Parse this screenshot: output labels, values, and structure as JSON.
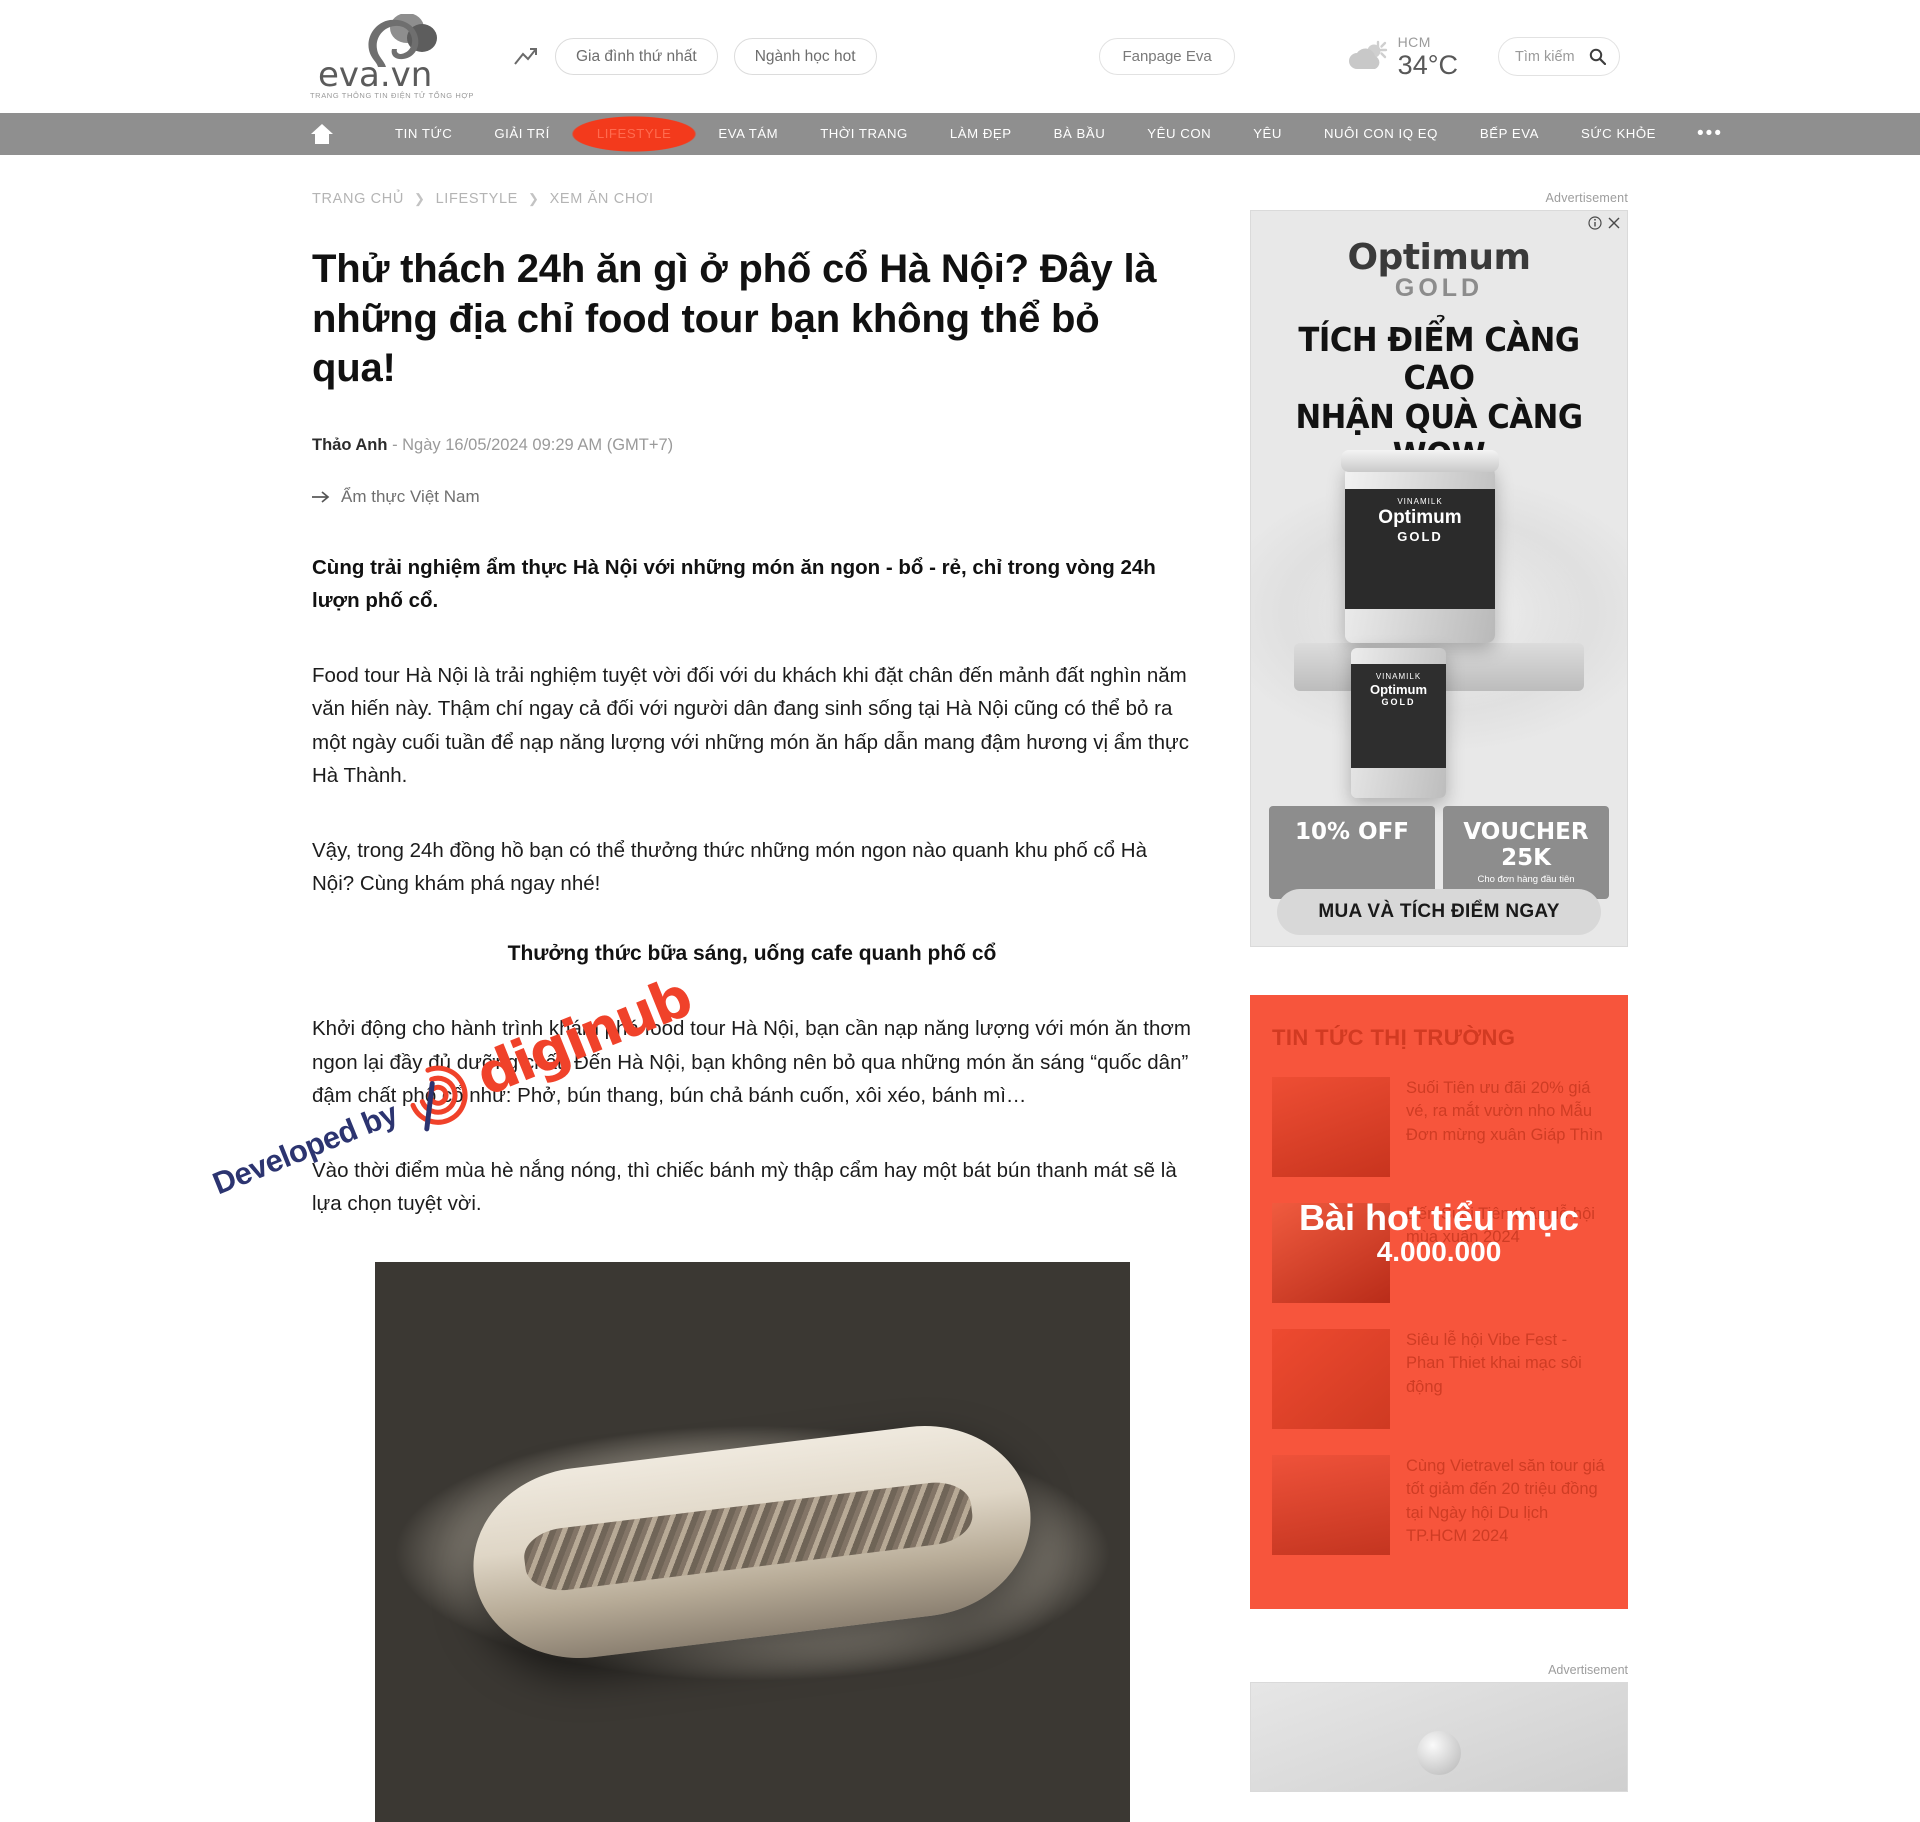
{
  "header": {
    "logo": {
      "name": "eva.vn",
      "tagline": "TRANG THÔNG TIN ĐIỆN TỬ TỔNG HỢP"
    },
    "trend_icon": "trending-up-icon",
    "hot_topics": [
      "Gia đình thứ nhất",
      "Ngành học hot"
    ],
    "fanpage_label": "Fanpage Eva",
    "weather": {
      "icon": "cloud-sun-icon",
      "city": "HCM",
      "temperature": "34°C"
    },
    "search": {
      "placeholder": "Tìm kiếm",
      "icon": "search-icon"
    }
  },
  "nav": {
    "home_icon": "home-icon",
    "items": [
      {
        "label": "TIN TỨC",
        "active": false
      },
      {
        "label": "GIẢI TRÍ",
        "active": false
      },
      {
        "label": "LIFESTYLE",
        "active": true
      },
      {
        "label": "EVA TÁM",
        "active": false
      },
      {
        "label": "THỜI TRANG",
        "active": false
      },
      {
        "label": "LÀM ĐẸP",
        "active": false
      },
      {
        "label": "BÀ BẦU",
        "active": false
      },
      {
        "label": "YÊU CON",
        "active": false
      },
      {
        "label": "YÊU",
        "active": false
      },
      {
        "label": "NUÔI CON IQ EQ",
        "active": false
      },
      {
        "label": "BẾP EVA",
        "active": false
      },
      {
        "label": "SỨC KHỎE",
        "active": false
      }
    ],
    "more_label": "•••"
  },
  "article": {
    "breadcrumb": [
      "TRANG CHỦ",
      "LIFESTYLE",
      "XEM ĂN CHƠI"
    ],
    "breadcrumb_separator": "❯",
    "title": "Thử thách 24h ăn gì ở phố cổ Hà Nội? Đây là những địa chỉ food tour bạn không thể bỏ qua!",
    "author": "Thảo Anh",
    "date": "- Ngày 16/05/2024 09:29 AM (GMT+7)",
    "topic_icon": "arrow-right-icon",
    "topic": "Ẩm thực Việt Nam",
    "sapo": "Cùng trải nghiệm ẩm thực Hà Nội với những món ăn ngon - bổ - rẻ, chỉ trong vòng 24h lượn phố cổ.",
    "paragraph_1": "Food tour Hà Nội là trải nghiệm tuyệt vời đối với du khách khi đặt chân đến mảnh đất nghìn năm văn hiến này. Thậm chí ngay cả đối với người dân đang sinh sống tại Hà Nội cũng có thể bỏ ra một ngày cuối tuần để nạp năng lượng với những món ăn hấp dẫn mang đậm hương vị ẩm thực Hà Thành.",
    "paragraph_2": "Vậy, trong 24h đồng hồ bạn có thể thưởng thức những món ngon nào quanh khu phố cổ Hà Nội? Cùng khám phá ngay nhé!",
    "subheading": "Thưởng thức bữa sáng, uống cafe quanh phố cổ",
    "paragraph_3": "Khởi động cho hành trình khám phá food tour Hà Nội, bạn cần nạp năng lượng với món ăn thơm ngon lại đầy đủ dưỡng chất. Đến Hà Nội, bạn không nên bỏ qua những món ăn sáng “quốc dân” đậm chất phố cổ như: Phở, bún thang, bún chả bánh cuốn, xôi xéo, bánh mì…",
    "paragraph_4": "Vào thời điểm mùa hè nắng nóng, thì chiếc bánh mỳ thập cẩm hay một bát bún thanh mát sẽ là lựa chọn tuyệt vời.",
    "photo_name": "banh-my-photo"
  },
  "watermark": {
    "developed_by": "Developed by",
    "brand": "diginub",
    "logo_icon": "spiral-fingerprint-icon"
  },
  "sidebar": {
    "ad_label": "Advertisement",
    "ad": {
      "info_icon": "info-icon",
      "close_icon": "close-icon",
      "brand_line1": "Optimum",
      "brand_line2": "GOLD",
      "headline_line1": "TÍCH ĐIỂM CÀNG CAO",
      "headline_line2": "NHẬN QUÀ CÀNG WOW",
      "product_brand": "VINAMILK",
      "product_name": "Optimum",
      "product_sub": "GOLD",
      "coupon_1_main": "10% OFF",
      "coupon_1_sub": "",
      "coupon_2_main": "VOUCHER 25K",
      "coupon_2_sub": "Cho đơn hàng đầu tiên",
      "cta": "MUA VÀ TÍCH ĐIỂM NGAY"
    },
    "market": {
      "title": "TIN TỨC THỊ TRƯỜNG",
      "items": [
        {
          "thumb": "suoi-tien-thumb",
          "text": "Suối Tiên ưu đãi 20% giá vé, ra mắt vườn nho Mẫu Đơn mừng xuân Giáp Thìn"
        },
        {
          "thumb": "suoi-tien-festival-thumb",
          "text": "Đến Suối Tiên thăm lễ hội mùa xuân 2024"
        },
        {
          "thumb": "vibe-fest-thumb",
          "text": "Siêu lễ hội Vibe Fest - Phan Thiet khai mạc sôi động"
        },
        {
          "thumb": "vietravel-thumb",
          "text": "Cùng Vietravel săn tour giá tốt giảm đến 20 triệu đồng tại Ngày hội Du lịch TP.HCM 2024"
        }
      ],
      "watermark_line1": "Bài hot tiểu mục",
      "watermark_line2": "4.000.000"
    },
    "ad2_label": "Advertisement"
  },
  "colors": {
    "accent_red": "#f6381c",
    "market_bg": "#f7553c",
    "nav_bg": "#8f8f8f",
    "watermark_blue": "#2c3470",
    "watermark_red": "#f0422a"
  }
}
